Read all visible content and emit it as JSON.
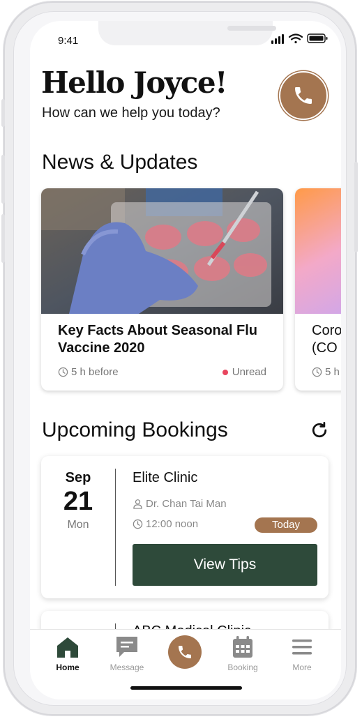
{
  "status_bar": {
    "time": "9:41"
  },
  "header": {
    "greeting": "Hello Joyce!",
    "subtitle": "How can we help you today?"
  },
  "news": {
    "section_title": "News & Updates",
    "cards": [
      {
        "title": "Key Facts About Seasonal Flu Vaccine 2020",
        "time": "5 h before",
        "status": "Unread"
      },
      {
        "title": "Coro (CO",
        "time": "5 h"
      }
    ]
  },
  "bookings": {
    "section_title": "Upcoming Bookings",
    "items": [
      {
        "month": "Sep",
        "day": "21",
        "weekday": "Mon",
        "clinic": "Elite Clinic",
        "doctor": "Dr. Chan Tai Man",
        "time": "12:00 noon",
        "badge": "Today",
        "action": "View Tips"
      },
      {
        "clinic": "ABC Medical Clinic"
      }
    ]
  },
  "tabbar": {
    "items": [
      {
        "label": "Home",
        "icon": "home-icon"
      },
      {
        "label": "Message",
        "icon": "message-icon"
      },
      {
        "label": "",
        "icon": "phone-icon"
      },
      {
        "label": "Booking",
        "icon": "calendar-icon"
      },
      {
        "label": "More",
        "icon": "menu-icon"
      }
    ]
  },
  "colors": {
    "accent_brown": "#a47550",
    "dark_green": "#2e4a3a",
    "unread_red": "#e8455e"
  }
}
